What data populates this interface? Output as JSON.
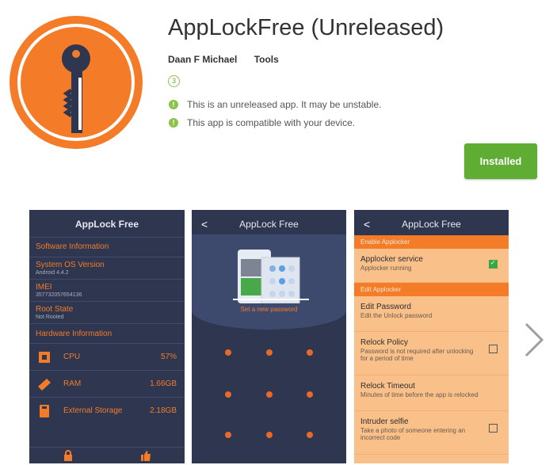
{
  "app": {
    "title": "AppLockFree (Unreleased)",
    "developer": "Daan F Michael",
    "category": "Tools",
    "rating_badge": "3",
    "notices": [
      "This is an unreleased app. It may be unstable.",
      "This app is compatible with your device."
    ],
    "install_button": "Installed"
  },
  "colors": {
    "accent_orange": "#f47c29",
    "panel_navy": "#2e3650",
    "install_green": "#5fad33",
    "panel_peach": "#f9c089"
  },
  "screenshots": {
    "one": {
      "header": "AppLock Free",
      "software_section": "Software Information",
      "rows": [
        {
          "label": "System OS Version",
          "value": "Android 4.4.2"
        },
        {
          "label": "IMEI",
          "value": "357732057654136"
        },
        {
          "label": "Root State",
          "value": "Not Rooted"
        }
      ],
      "hardware_section": "Hardware Information",
      "hardware": [
        {
          "name": "CPU",
          "value": "57%",
          "icon": "cpu-icon"
        },
        {
          "name": "RAM",
          "value": "1.66GB",
          "icon": "ram-icon"
        },
        {
          "name": "External Storage",
          "value": "2.18GB",
          "icon": "storage-icon"
        }
      ]
    },
    "two": {
      "header": "AppLock Free",
      "back": "<",
      "prompt": "Set a new password"
    },
    "three": {
      "header": "AppLock Free",
      "back": "<",
      "section_enable": "Enable Applocker",
      "section_edit": "Edit Applocker",
      "items": [
        {
          "title": "Applocker service",
          "subtitle": "Applocker running",
          "checked": true
        },
        {
          "title": "Edit Password",
          "subtitle": "Edit the Unlock password"
        },
        {
          "title": "Relock Policy",
          "subtitle": "Password is not required after unlocking for a period of time",
          "checked": false
        },
        {
          "title": "Relock Timeout",
          "subtitle": "Minutes of time before the app is relocked"
        },
        {
          "title": "Intruder selfie",
          "subtitle": "Take a photo of someone entering an incorrect code",
          "checked": false
        }
      ]
    }
  }
}
